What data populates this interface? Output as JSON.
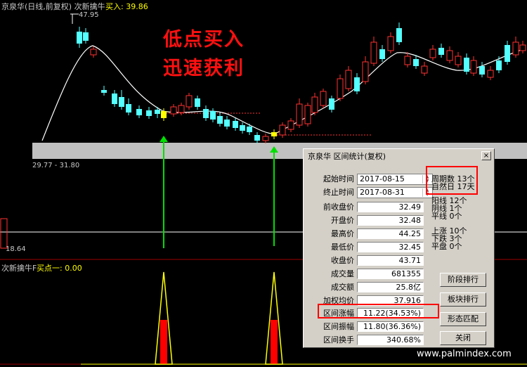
{
  "header": {
    "stock_title": "京泉华(日线,前复权) 次新擒牛",
    "buy_label": "买入: 39.86",
    "high_label": "47.95",
    "range_label": "29.77 - 31.80",
    "low_label": "18.64"
  },
  "promo": {
    "line1": "低点买入",
    "line2": "迅速获利"
  },
  "indicator": {
    "name": "次新擒牛F",
    "signal": "买点一: 0.00"
  },
  "dialog": {
    "title": "京泉华 区间统计(复权)",
    "close_symbol": "×",
    "start_label": "起始时间",
    "start_value": "2017-08-15",
    "end_label": "终止时间",
    "end_value": "2017-08-31",
    "rows": [
      {
        "label": "前收盘价",
        "value": "32.49"
      },
      {
        "label": "开盘价",
        "value": "32.48"
      },
      {
        "label": "最高价",
        "value": "44.25"
      },
      {
        "label": "最低价",
        "value": "32.45"
      },
      {
        "label": "收盘价",
        "value": "43.71"
      },
      {
        "label": "成交量",
        "value": "681355"
      },
      {
        "label": "成交额",
        "value": "25.8亿"
      },
      {
        "label": "加权均价",
        "value": "37.916"
      },
      {
        "label": "区间涨幅",
        "value": "11.22(34.53%)"
      },
      {
        "label": "区间振幅",
        "value": "11.80(36.36%)"
      },
      {
        "label": "区间换手",
        "value": "340.68%"
      }
    ],
    "stats": {
      "period": "周期数  13个",
      "natural_days": "自然日  17天",
      "yang": "阳线  12个",
      "yin": "阴线  1个",
      "flat_line": "平线  0个",
      "up": "上涨  10个",
      "down": "下跌  3个",
      "flat": "平盘  0个"
    },
    "buttons": {
      "stage_rank": "阶段排行",
      "sector_rank": "板块排行",
      "pattern_match": "形态匹配",
      "close": "关闭"
    }
  },
  "watermark": "www.palmindex.com",
  "colors": {
    "up": "#ff3232",
    "down": "#54ffff",
    "signal_yellow": "#ffff00",
    "arrow_green": "#00e000",
    "promo_red": "#ff1010"
  },
  "chart_data": {
    "type": "candlestick",
    "price_markers": {
      "high": 47.95,
      "low": 18.64,
      "buy": 39.86
    }
  }
}
